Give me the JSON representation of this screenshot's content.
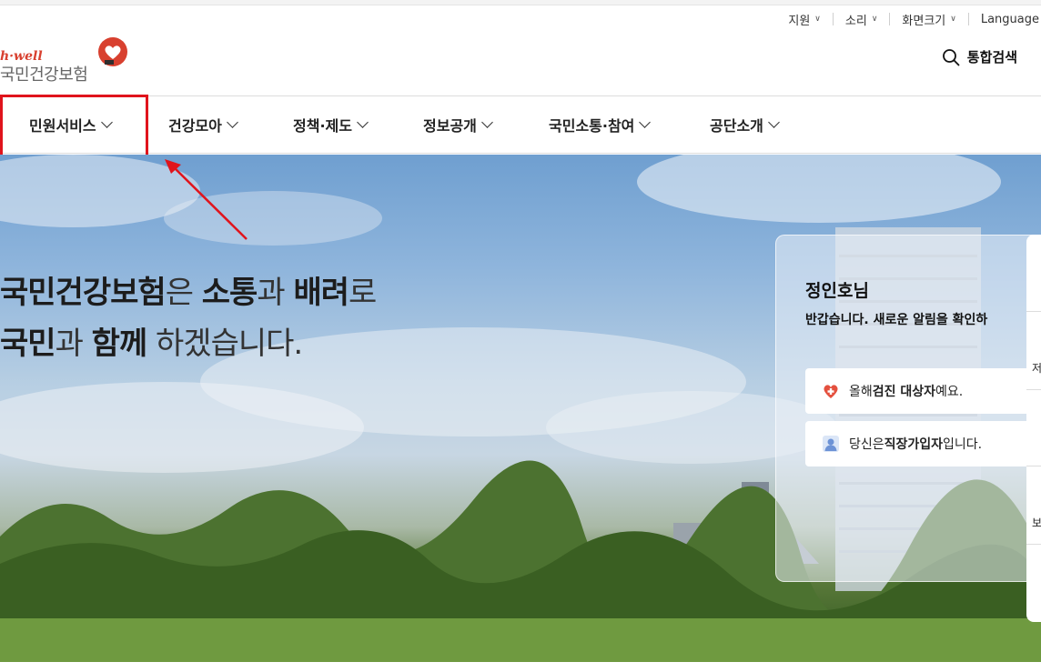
{
  "utility_bar": {
    "support": "지원",
    "sound": "소리",
    "screen_size": "화면크기",
    "language": "Language"
  },
  "logo": {
    "tagline": "h·well",
    "name": "국민건강보험"
  },
  "search": {
    "label": "통합검색"
  },
  "nav": [
    {
      "label": "민원서비스"
    },
    {
      "label": "건강모아"
    },
    {
      "label": "정책·제도"
    },
    {
      "label": "정보공개"
    },
    {
      "label": "국민소통·참여"
    },
    {
      "label": "공단소개"
    }
  ],
  "hero": {
    "line1": {
      "part1": "국민건강보험",
      "part2": "은 ",
      "part3": "소통",
      "part4": "과 ",
      "part5": "배려",
      "part6": "로"
    },
    "line2": {
      "part1": "국민",
      "part2": "과 ",
      "part3": "함께",
      "part4": " 하겠습니다."
    }
  },
  "user_panel": {
    "user_name": "정인호님",
    "greeting": "반갑습니다. 새로운 알림을 확인하",
    "cards": [
      {
        "pre": "올해 ",
        "bold": "검진 대상자",
        "post": "예요."
      },
      {
        "pre": "당신은 ",
        "bold": "직장가입자",
        "post": "입니다."
      }
    ]
  },
  "side_panel": {
    "label1": "저",
    "label2": "보"
  },
  "colors": {
    "brand_red": "#d8402f",
    "highlight_red": "#e0141c"
  }
}
